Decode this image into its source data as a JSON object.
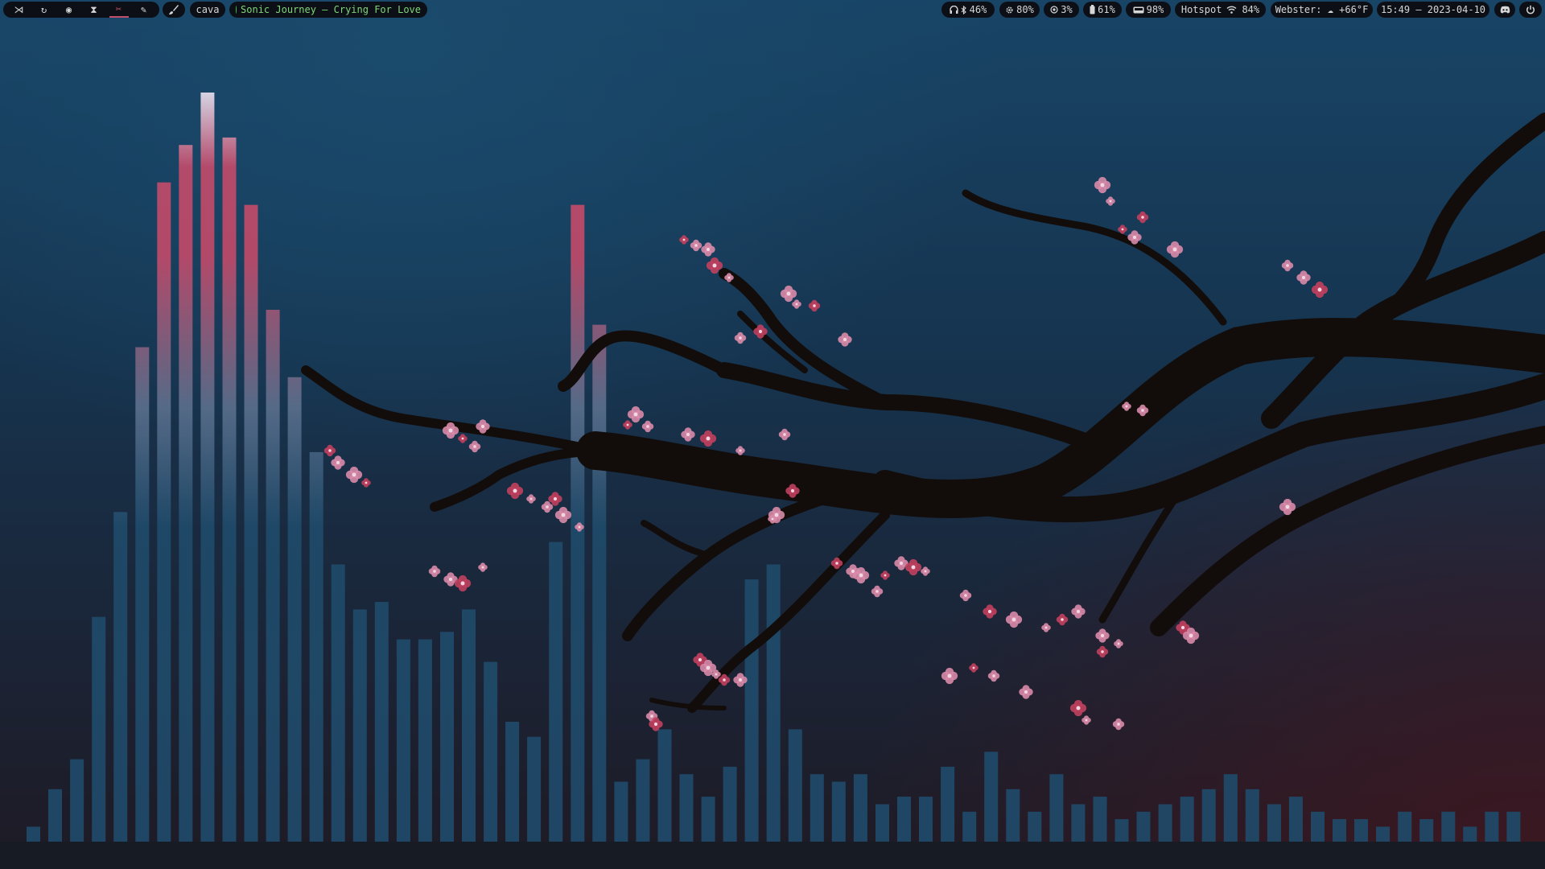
{
  "topbar": {
    "workspaces": [
      {
        "icon": "vscode-icon",
        "glyph": "⋊",
        "active": false
      },
      {
        "icon": "refresh-icon",
        "glyph": "↻",
        "active": false
      },
      {
        "icon": "spotify-icon",
        "glyph": "◉",
        "active": false
      },
      {
        "icon": "hourglass-icon",
        "glyph": "⧗",
        "active": false
      },
      {
        "icon": "scissors-icon",
        "glyph": "✂",
        "active": true
      },
      {
        "icon": "pen-icon",
        "glyph": "✎",
        "active": false
      }
    ],
    "brush_icon": "brush-icon",
    "cava_label": "cava",
    "media": {
      "title": "Sonic Journey – Crying For Love",
      "status_color": "#3bbd4a"
    },
    "status": {
      "bluetooth": "46%",
      "cpu": "80%",
      "memory": "3%",
      "battery": "61%",
      "disk": "98%",
      "network_name": "Hotspot",
      "network_strength": "84%",
      "weather": "Webster: ☁ +66°F",
      "clock": "15:49 – 2023-04-10"
    }
  },
  "visualizer": {
    "bar_levels": [
      2,
      7,
      11,
      30,
      44,
      66,
      88,
      93,
      100,
      94,
      85,
      71,
      62,
      52,
      37,
      31,
      32,
      27,
      27,
      28,
      31,
      24,
      16,
      14,
      40,
      85,
      69,
      8,
      11,
      15,
      9,
      6,
      10,
      35,
      37,
      15,
      9,
      8,
      9,
      5,
      6,
      6,
      10,
      4,
      12,
      7,
      4,
      9,
      5,
      6,
      3,
      4,
      5,
      6,
      7,
      9,
      7,
      5,
      6,
      4,
      3,
      3,
      2,
      4,
      3,
      4,
      2,
      4,
      4
    ],
    "colors": {
      "base": "#1f4a6a",
      "mid": "#5a6f8c",
      "hot": "#c04a6a",
      "peak": "#e6e0ee"
    }
  },
  "tree_colors": {
    "branch": "#120d0b",
    "blossom": "#d88aa8",
    "blossom_dark": "#c0405e"
  }
}
